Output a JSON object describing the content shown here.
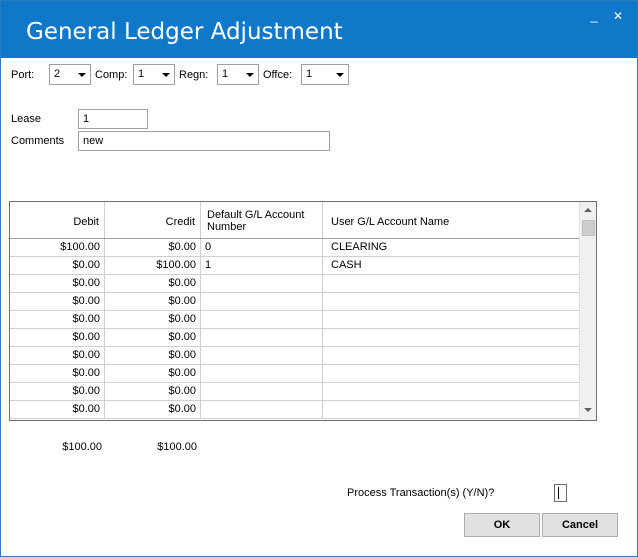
{
  "window": {
    "title": "General Ledger Adjustment",
    "minimize": "_",
    "close": "✕"
  },
  "selectors": [
    {
      "label": "Port:",
      "value": "2"
    },
    {
      "label": "Comp:",
      "value": "1"
    },
    {
      "label": "Regn:",
      "value": "1"
    },
    {
      "label": "Offce:",
      "value": "1"
    }
  ],
  "fields": {
    "lease_label": "Lease",
    "lease_value": "1",
    "comments_label": "Comments",
    "comments_value": "new"
  },
  "grid": {
    "headers": [
      "Debit",
      "Credit",
      "Default G/L Account Number",
      "User G/L Account Name"
    ],
    "header_line1": "Default G/L Account",
    "header_line2": "Number",
    "rows": [
      {
        "debit": "$100.00",
        "credit": "$0.00",
        "account": "0",
        "name": "CLEARING"
      },
      {
        "debit": "$0.00",
        "credit": "$100.00",
        "account": "1",
        "name": "CASH"
      },
      {
        "debit": "$0.00",
        "credit": "$0.00",
        "account": "",
        "name": ""
      },
      {
        "debit": "$0.00",
        "credit": "$0.00",
        "account": "",
        "name": ""
      },
      {
        "debit": "$0.00",
        "credit": "$0.00",
        "account": "",
        "name": ""
      },
      {
        "debit": "$0.00",
        "credit": "$0.00",
        "account": "",
        "name": ""
      },
      {
        "debit": "$0.00",
        "credit": "$0.00",
        "account": "",
        "name": ""
      },
      {
        "debit": "$0.00",
        "credit": "$0.00",
        "account": "",
        "name": ""
      },
      {
        "debit": "$0.00",
        "credit": "$0.00",
        "account": "",
        "name": ""
      },
      {
        "debit": "$0.00",
        "credit": "$0.00",
        "account": "",
        "name": ""
      }
    ]
  },
  "totals": {
    "debit": "$100.00",
    "credit": "$100.00"
  },
  "process": {
    "label": "Process Transaction(s) (Y/N)?",
    "value": ""
  },
  "buttons": {
    "ok": "OK",
    "cancel": "Cancel"
  }
}
